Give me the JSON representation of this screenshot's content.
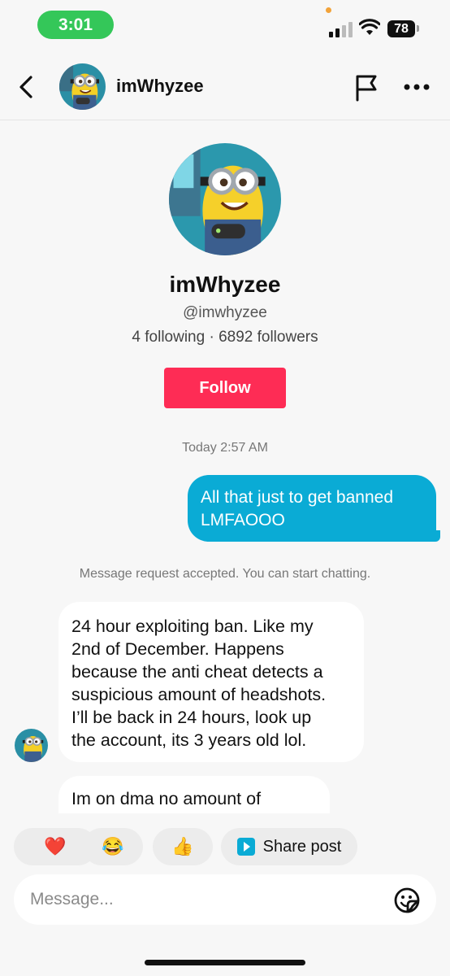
{
  "status_bar": {
    "time": "3:01",
    "battery": "78",
    "icons": [
      "signal-icon",
      "wifi-icon",
      "battery-icon"
    ]
  },
  "header": {
    "back_icon": "chevron-left-icon",
    "name": "imWhyzee",
    "flag_icon": "flag-icon",
    "more_icon": "more-horizontal-icon"
  },
  "profile": {
    "name": "imWhyzee",
    "handle": "@imwhyzee",
    "stats": "4 following · 6892 followers",
    "follow_label": "Follow"
  },
  "conversation": {
    "timestamp": "Today 2:57 AM",
    "outgoing": {
      "line1": "All that just to get banned",
      "line2": "LMFAOOO"
    },
    "system_note": "Message request accepted. You can start chatting.",
    "incoming": [
      {
        "lines": [
          "24 hour exploiting ban. Like my",
          "2nd of December. Happens",
          "because the anti cheat detects a",
          "suspicious amount of headshots.",
          "I’ll be back in 24 hours, look up",
          "the account, its 3 years old lol."
        ]
      },
      {
        "lines": [
          "Im on dma no amount of"
        ]
      }
    ]
  },
  "quick_replies": {
    "heart": "❤️",
    "laugh": "😂",
    "thumb": "👍",
    "share_label": "Share post"
  },
  "composer": {
    "placeholder": "Message...",
    "emoji_icon": "emoji-sticker-icon"
  },
  "colors": {
    "follow": "#fe2c55",
    "outgoing_bubble": "#0aabd5",
    "time_pill": "#34c759"
  }
}
